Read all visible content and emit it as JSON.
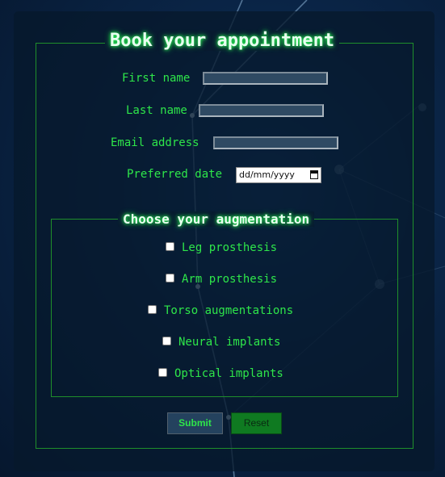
{
  "form": {
    "title": "Book your appointment",
    "fields": [
      {
        "label": "First name",
        "value": ""
      },
      {
        "label": "Last name",
        "value": ""
      },
      {
        "label": "Email address",
        "value": ""
      },
      {
        "label": "Preferred date",
        "placeholder": "dd/mm/yyyy"
      }
    ]
  },
  "augmentation": {
    "title": "Choose your augmentation",
    "options": [
      {
        "label": "Leg prosthesis",
        "checked": false
      },
      {
        "label": "Arm prosthesis",
        "checked": false
      },
      {
        "label": "Torso augmentations",
        "checked": false
      },
      {
        "label": "Neural implants",
        "checked": false
      },
      {
        "label": "Optical implants",
        "checked": false
      }
    ]
  },
  "actions": {
    "submit_label": "Submit",
    "reset_label": "Reset"
  },
  "colors": {
    "accent_green": "#2ee64a",
    "border_green": "#1f8f2b",
    "background": "#0a2547"
  }
}
